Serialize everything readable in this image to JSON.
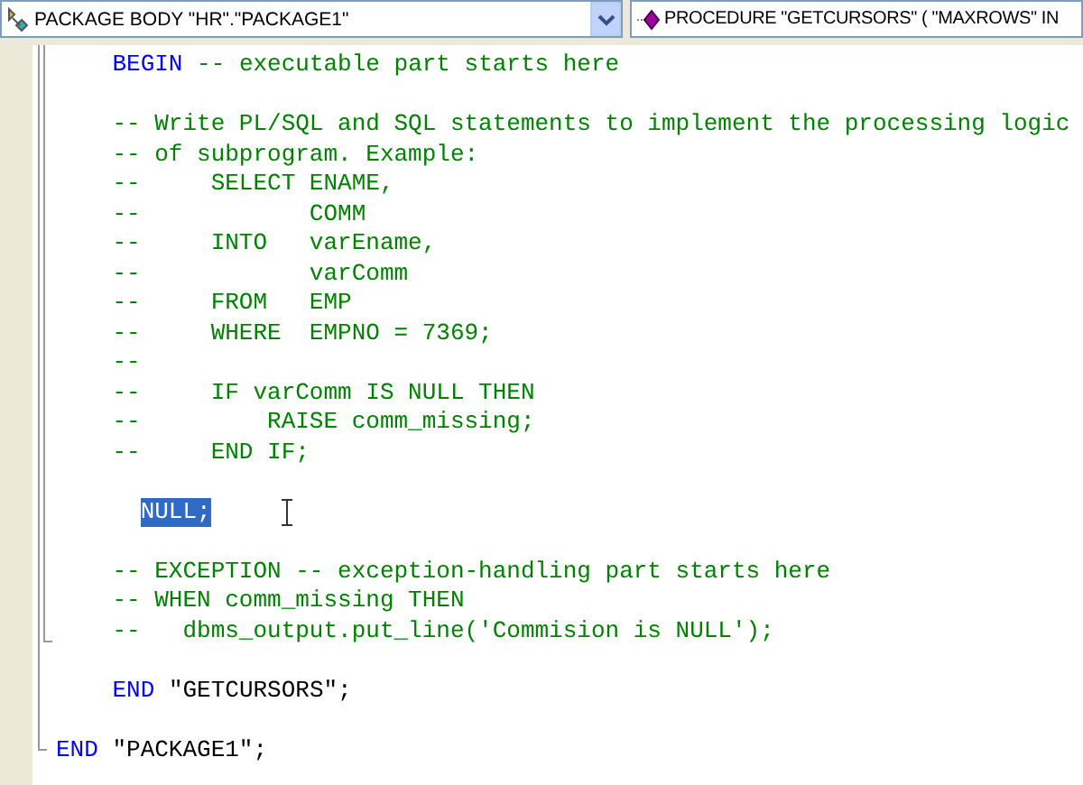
{
  "toolbar": {
    "object_selector": {
      "value": "PACKAGE BODY \"HR\".\"PACKAGE1\""
    },
    "member_selector": {
      "value": "PROCEDURE \"GETCURSORS\" ( \"MAXROWS\" IN"
    }
  },
  "editor": {
    "lines": [
      {
        "kind": "code",
        "segments": [
          {
            "kind": "keyword",
            "text": "    BEGIN"
          },
          {
            "kind": "comment",
            "text": " -- executable part starts here"
          }
        ]
      },
      {
        "kind": "blank"
      },
      {
        "kind": "code",
        "segments": [
          {
            "kind": "comment",
            "text": "    -- Write PL/SQL and SQL statements to implement the processing logic"
          }
        ]
      },
      {
        "kind": "code",
        "segments": [
          {
            "kind": "comment",
            "text": "    -- of subprogram. Example:"
          }
        ]
      },
      {
        "kind": "code",
        "segments": [
          {
            "kind": "comment",
            "text": "    --     SELECT ENAME,"
          }
        ]
      },
      {
        "kind": "code",
        "segments": [
          {
            "kind": "comment",
            "text": "    --            COMM"
          }
        ]
      },
      {
        "kind": "code",
        "segments": [
          {
            "kind": "comment",
            "text": "    --     INTO   varEname,"
          }
        ]
      },
      {
        "kind": "code",
        "segments": [
          {
            "kind": "comment",
            "text": "    --            varComm"
          }
        ]
      },
      {
        "kind": "code",
        "segments": [
          {
            "kind": "comment",
            "text": "    --     FROM   EMP"
          }
        ]
      },
      {
        "kind": "code",
        "segments": [
          {
            "kind": "comment",
            "text": "    --     WHERE  EMPNO = 7369;"
          }
        ]
      },
      {
        "kind": "code",
        "segments": [
          {
            "kind": "comment",
            "text": "    --"
          }
        ]
      },
      {
        "kind": "code",
        "segments": [
          {
            "kind": "comment",
            "text": "    --     IF varComm IS NULL THEN"
          }
        ]
      },
      {
        "kind": "code",
        "segments": [
          {
            "kind": "comment",
            "text": "    --         RAISE comm_missing;"
          }
        ]
      },
      {
        "kind": "code",
        "segments": [
          {
            "kind": "comment",
            "text": "    --     END IF;"
          }
        ]
      },
      {
        "kind": "blank"
      },
      {
        "kind": "code",
        "segments": [
          {
            "kind": "selected",
            "text": "      NULL;"
          }
        ],
        "text_cursor": true
      },
      {
        "kind": "blank"
      },
      {
        "kind": "code",
        "segments": [
          {
            "kind": "comment",
            "text": "    -- EXCEPTION -- exception-handling part starts here"
          }
        ]
      },
      {
        "kind": "code",
        "segments": [
          {
            "kind": "comment",
            "text": "    -- WHEN comm_missing THEN"
          }
        ]
      },
      {
        "kind": "code",
        "segments": [
          {
            "kind": "comment",
            "text": "    --   dbms_output.put_line('Commision is NULL');"
          }
        ]
      },
      {
        "kind": "blank"
      },
      {
        "kind": "code",
        "segments": [
          {
            "kind": "keyword",
            "text": "    END"
          },
          {
            "kind": "plain",
            "text": " \"GETCURSORS\";"
          }
        ]
      },
      {
        "kind": "blank"
      },
      {
        "kind": "code",
        "segments": [
          {
            "kind": "keyword",
            "text": "END"
          },
          {
            "kind": "plain",
            "text": " \"PACKAGE1\";"
          }
        ]
      }
    ]
  }
}
